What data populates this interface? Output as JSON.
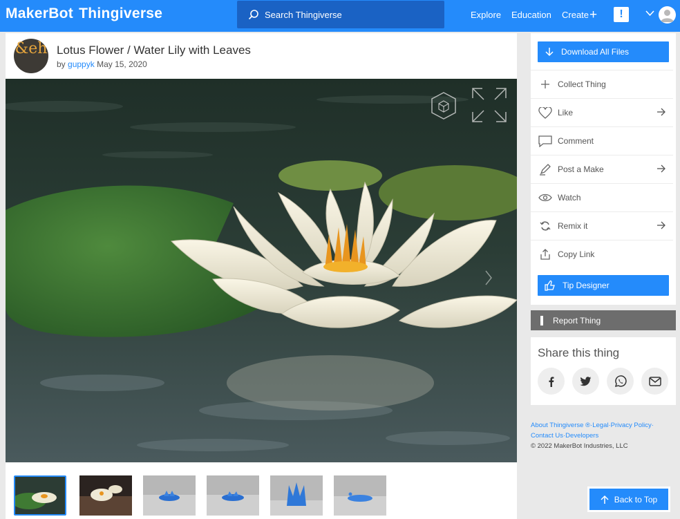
{
  "header": {
    "logo_part1": "MakerBot",
    "logo_part2": "Thingiverse",
    "search_placeholder": "Search Thingiverse",
    "nav": [
      "Explore",
      "Education",
      "Create"
    ],
    "alert_glyph": "!",
    "brand_color": "#248bfb"
  },
  "thing": {
    "creator_initials": "&eh",
    "title": "Lotus Flower / Water Lily with Leaves",
    "by": "by",
    "author": "guppyk",
    "date": "May 15, 2020",
    "thumbnail_count": 6
  },
  "actions": {
    "download": "Download All Files",
    "items": [
      {
        "label": "Collect Thing",
        "icon": "plus-icon",
        "arrow": false
      },
      {
        "label": "Like",
        "icon": "heart-icon",
        "arrow": true
      },
      {
        "label": "Comment",
        "icon": "comment-icon",
        "arrow": false
      },
      {
        "label": "Post a Make",
        "icon": "pen-icon",
        "arrow": true
      },
      {
        "label": "Watch",
        "icon": "eye-icon",
        "arrow": false
      },
      {
        "label": "Remix it",
        "icon": "remix-icon",
        "arrow": true
      },
      {
        "label": "Copy Link",
        "icon": "share-icon",
        "arrow": false
      }
    ],
    "tip": "Tip Designer",
    "report": "Report Thing"
  },
  "share": {
    "title": "Share this thing",
    "networks": [
      "facebook-icon",
      "twitter-icon",
      "whatsapp-icon",
      "email-icon"
    ]
  },
  "footer": {
    "about": "About Thingiverse ®",
    "sep": "·",
    "legal": "Legal",
    "privacy": "Privacy Policy",
    "contact": "Contact Us",
    "developers": "Developers",
    "copyright": "© 2022 MakerBot Industries, LLC"
  },
  "back_to_top": "Back to Top"
}
